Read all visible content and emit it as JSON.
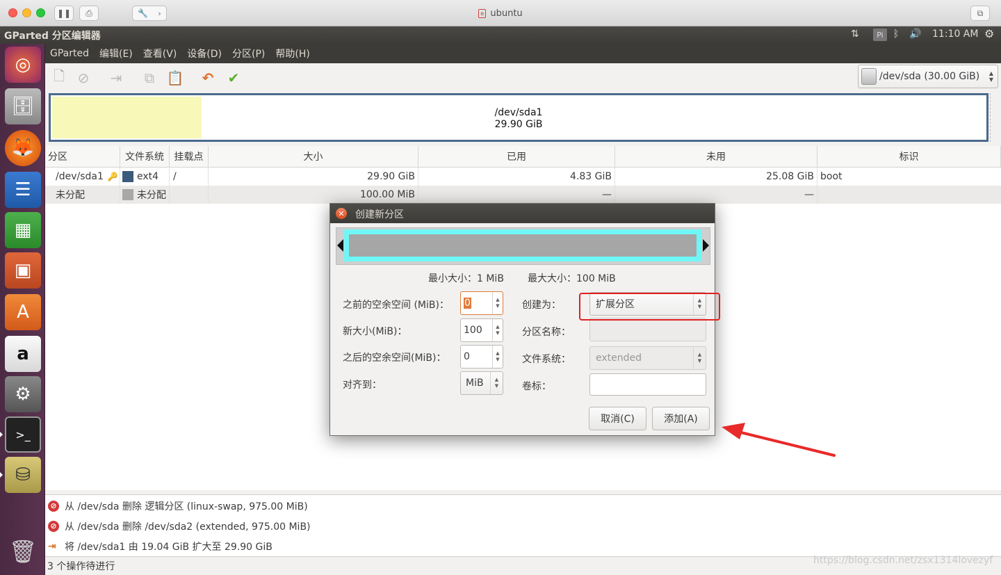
{
  "mac": {
    "title": "ubuntu"
  },
  "panel": {
    "app_title": "GParted 分区编辑器",
    "time": "11:10 AM",
    "kbd": "Pi"
  },
  "menu": [
    "GParted",
    "编辑(E)",
    "查看(V)",
    "设备(D)",
    "分区(P)",
    "帮助(H)"
  ],
  "device": {
    "label": "/dev/sda  (30.00 GiB)"
  },
  "diskmap": {
    "name": "/dev/sda1",
    "size": "29.90 GiB",
    "used_fraction": 0.16
  },
  "table": {
    "headers": [
      "分区",
      "文件系统",
      "挂载点",
      "大小",
      "已用",
      "未用",
      "标识"
    ],
    "rows": [
      {
        "partition": "/dev/sda1",
        "fs": "ext4",
        "fs_color": "#3b5b7c",
        "mount": "/",
        "size": "29.90 GiB",
        "used": "4.83 GiB",
        "unused": "25.08 GiB",
        "flags": "boot"
      },
      {
        "partition": "未分配",
        "fs": "未分配",
        "fs_color": "#a8a8a8",
        "mount": "",
        "size": "100.00 MiB",
        "used": "—",
        "unused": "—",
        "flags": ""
      }
    ]
  },
  "log": [
    "从 /dev/sda 删除 逻辑分区 (linux-swap, 975.00 MiB)",
    "从 /dev/sda 删除 /dev/sda2 (extended, 975.00 MiB)",
    "将 /dev/sda1 由 19.04 GiB 扩大至 29.90 GiB"
  ],
  "status": "3 个操作待进行",
  "watermark": "https://blog.csdn.net/zsx1314lovezyf",
  "dialog": {
    "title": "创建新分区",
    "min_size": "最小大小：1 MiB",
    "max_size": "最大大小：100 MiB",
    "free_before_label": "之前的空余空间 (MiB)：",
    "free_before_value": "0",
    "new_size_label": "新大小(MiB)：",
    "new_size_value": "100",
    "free_after_label": "之后的空余空间(MiB)：",
    "free_after_value": "0",
    "align_label": "对齐到：",
    "align_value": "MiB",
    "create_as_label": "创建为：",
    "create_as_value": "扩展分区",
    "part_name_label": "分区名称：",
    "part_name_value": "",
    "fs_label": "文件系统：",
    "fs_value": "extended",
    "vol_label": "卷标：",
    "vol_value": "",
    "cancel": "取消(C)",
    "add": "添加(A)"
  },
  "colors": {
    "highlight": "#e02020",
    "arrow": "#e82a2a"
  }
}
